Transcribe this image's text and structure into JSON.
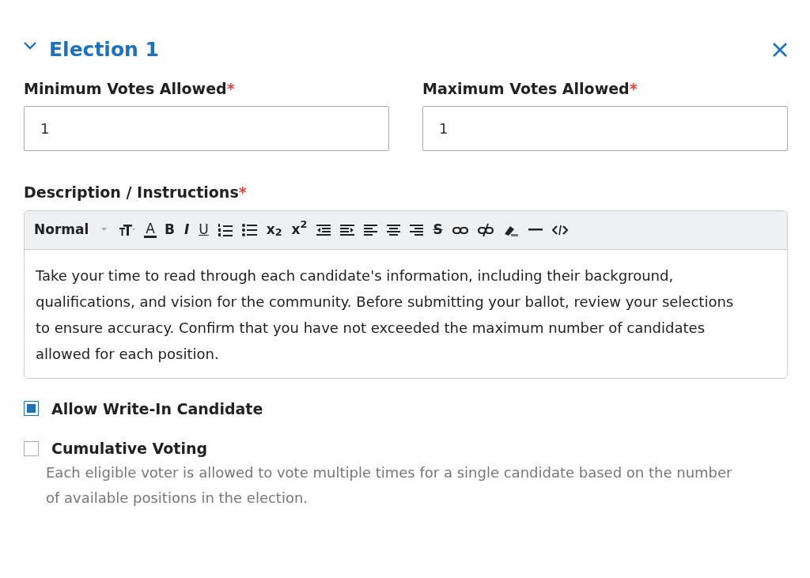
{
  "section": {
    "title": "Election 1",
    "expanded": true
  },
  "vote_fields": [
    {
      "label": "Minimum Votes Allowed",
      "required_mark": "*",
      "value": "1"
    },
    {
      "label": "Maximum Votes Allowed",
      "required_mark": "*",
      "value": "1"
    }
  ],
  "description": {
    "label": "Description / Instructions",
    "required_mark": "*",
    "toolbar": [
      {
        "kind": "dropdown",
        "label": "Normal"
      },
      {
        "kind": "font-size"
      },
      {
        "kind": "font-color",
        "label": "A"
      },
      {
        "kind": "bold",
        "label": "B"
      },
      {
        "kind": "italic",
        "label": "I"
      },
      {
        "kind": "underline",
        "label": "U"
      },
      {
        "kind": "ordered-list"
      },
      {
        "kind": "bullet-list"
      },
      {
        "kind": "subscript",
        "label": "x$_{2}$"
      },
      {
        "kind": "superscript",
        "label": "x$^{2}$"
      },
      {
        "kind": "outdent"
      },
      {
        "kind": "indent"
      },
      {
        "kind": "align-left"
      },
      {
        "kind": "align-center"
      },
      {
        "kind": "align-right"
      },
      {
        "kind": "strikethrough",
        "label": "S"
      },
      {
        "kind": "link"
      },
      {
        "kind": "unlink"
      },
      {
        "kind": "highlight"
      },
      {
        "kind": "rule"
      },
      {
        "kind": "code"
      }
    ],
    "value": "Take your time to read through each candidate's information, including their background, qualifications, and vision for the community. Before submitting your ballot, review your selections to ensure accuracy. Confirm that you have not exceeded the maximum number of candidates allowed for each position."
  },
  "options": [
    {
      "label": "Allow Write-In Candidate",
      "checked": true
    },
    {
      "label": "Cumulative Voting",
      "checked": false,
      "help": "Each eligible voter is allowed to vote multiple times for a single candidate based on the number of available positions in the election."
    }
  ]
}
